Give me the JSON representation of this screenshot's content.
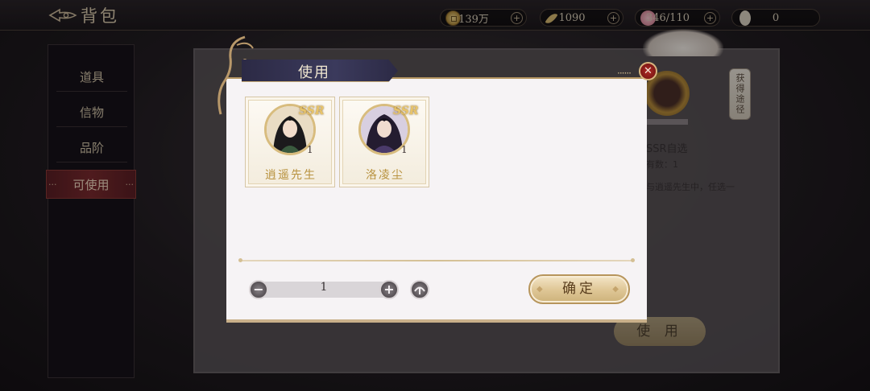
{
  "header": {
    "title": "背包",
    "back_icon": "back-arrow-icon"
  },
  "resources": [
    {
      "name": "coin",
      "icon": "coin-icon",
      "value": "139万"
    },
    {
      "name": "feather",
      "icon": "feather-icon",
      "value": "1090"
    },
    {
      "name": "flower",
      "icon": "flower-icon",
      "value": "346/110"
    },
    {
      "name": "scroll",
      "icon": "scroll-icon",
      "value": "0"
    }
  ],
  "sidebar": {
    "items": [
      {
        "label": "道具",
        "active": false
      },
      {
        "label": "信物",
        "active": false
      },
      {
        "label": "品阶",
        "active": false
      },
      {
        "label": "可使用",
        "active": true
      }
    ]
  },
  "background_panel": {
    "item_name": "SSR自选",
    "owned_text": "有数：1",
    "description": "与逍遥先生中，任选一",
    "acquire_label": "获得途径",
    "use_button": "使 用"
  },
  "modal": {
    "title": "使用",
    "characters": [
      {
        "name": "逍遥先生",
        "rarity": "SSR",
        "count": "1"
      },
      {
        "name": "洛凌尘",
        "rarity": "SSR",
        "count": "1"
      }
    ],
    "quantity": "1",
    "confirm_label": "确定"
  },
  "colors": {
    "accent_gold": "#d8bc7e",
    "active_tab": "#7a2a2e",
    "close_red": "#b02a26",
    "title_banner": "#3b3a5c"
  }
}
